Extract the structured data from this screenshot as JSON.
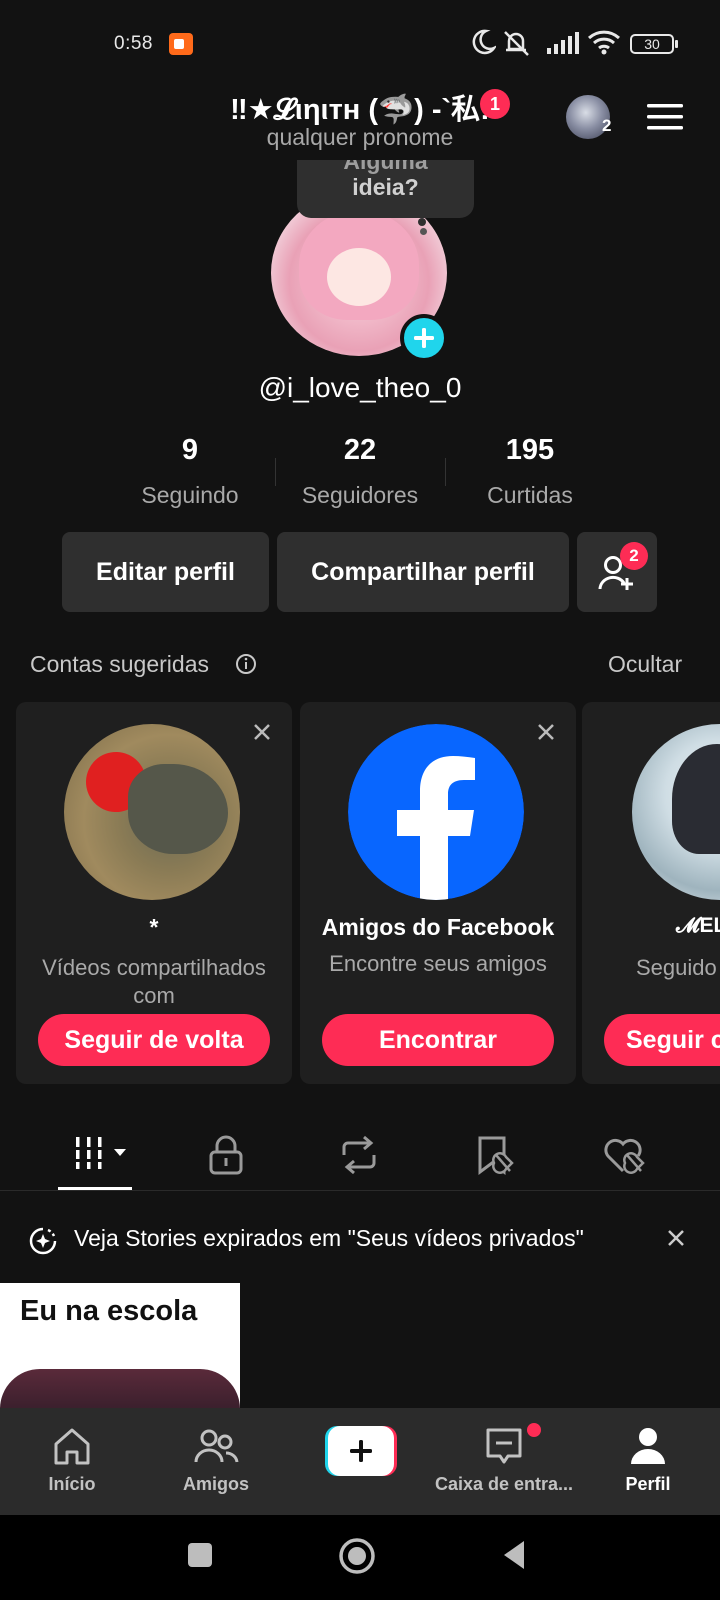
{
  "status_bar": {
    "time": "0:58",
    "battery": "30",
    "icons": [
      "screen-record-icon",
      "moon-icon",
      "mute-icon",
      "signal-icon",
      "wifi-icon",
      "battery-icon"
    ]
  },
  "header": {
    "display_name": "‼★𝓛ιηιтн (🦈) -`私!",
    "notification_count": "1",
    "pronoun": "qualquer pronome",
    "account_count": "2"
  },
  "tooltip": {
    "line1": "Alguma",
    "line2": "ideia?"
  },
  "profile": {
    "username": "@i_love_theo_0"
  },
  "stats": [
    {
      "value": "9",
      "label": "Seguindo"
    },
    {
      "value": "22",
      "label": "Seguidores"
    },
    {
      "value": "195",
      "label": "Curtidas"
    }
  ],
  "actions": {
    "edit": "Editar perfil",
    "share": "Compartilhar perfil",
    "add_friends_badge": "2"
  },
  "suggestions": {
    "title": "Contas sugeridas",
    "hide": "Ocultar",
    "cards": [
      {
        "name": "*",
        "subtitle": "Vídeos compartilhados com",
        "button": "Seguir de volta"
      },
      {
        "name": "Amigos do Facebook",
        "subtitle": "Encontre seus amigos",
        "button": "Encontrar"
      },
      {
        "name": "𝓜EL",
        "subtitle": "Seguido",
        "button": "Seguir c"
      }
    ]
  },
  "content_tabs": [
    "videos-grid-icon",
    "lock-icon",
    "repost-icon",
    "bookmark-icon",
    "liked-icon"
  ],
  "banner": {
    "text": "Veja Stories expirados em \"Seus vídeos privados\""
  },
  "video": {
    "caption": "Eu na escola"
  },
  "bottom_nav": {
    "home": "Início",
    "friends": "Amigos",
    "inbox": "Caixa de entra...",
    "profile": "Perfil"
  },
  "colors": {
    "accent": "#fe2c55",
    "cyan": "#20d5ec",
    "background": "#121212",
    "card": "#1f1f1f",
    "facebook": "#0866ff"
  }
}
